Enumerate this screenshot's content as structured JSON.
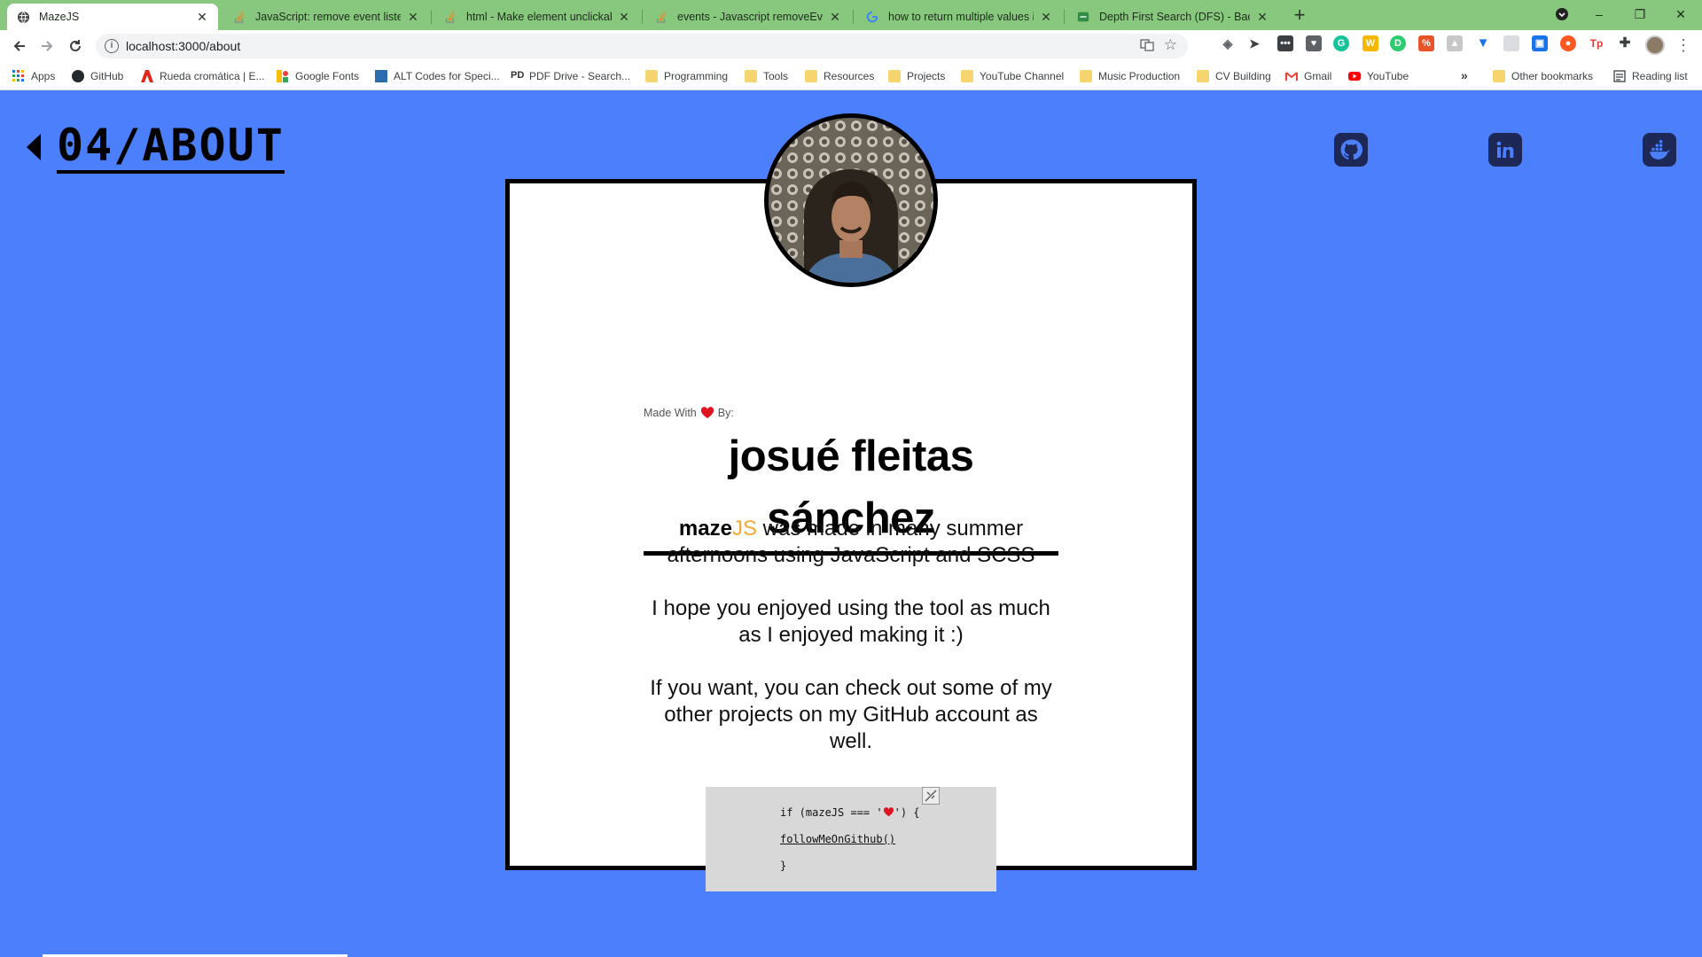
{
  "browser": {
    "tabs": [
      {
        "title": "MazeJS",
        "active": true,
        "favicon": "globe-icon"
      },
      {
        "title": "JavaScript: remove event listener",
        "active": false,
        "favicon": "stackoverflow-icon"
      },
      {
        "title": "html - Make element unclickable",
        "active": false,
        "favicon": "stackoverflow-icon"
      },
      {
        "title": "events - Javascript removeEventL",
        "active": false,
        "favicon": "stackoverflow-icon"
      },
      {
        "title": "how to return multiple values in",
        "active": false,
        "favicon": "google-icon"
      },
      {
        "title": "Depth First Search (DFS) - Backtr",
        "active": false,
        "favicon": "gfg-icon"
      }
    ],
    "tab_close": "✕",
    "new_tab": "+",
    "window_controls": {
      "minimize": "–",
      "maximize": "❐",
      "close": "✕"
    },
    "url": "localhost:3000/about",
    "bookmarks": [
      {
        "label": "Apps",
        "icon": "apps-grid-icon"
      },
      {
        "label": "GitHub",
        "icon": "github-icon"
      },
      {
        "label": "Rueda cromática | E...",
        "icon": "adobe-icon"
      },
      {
        "label": "Google Fonts",
        "icon": "google-fonts-icon"
      },
      {
        "label": "ALT Codes for Speci...",
        "icon": "altcodes-icon"
      },
      {
        "label": "PDF Drive - Search...",
        "icon": "pdfdrive-icon"
      },
      {
        "label": "Programming",
        "icon": "folder-icon"
      },
      {
        "label": "Tools",
        "icon": "folder-icon"
      },
      {
        "label": "Resources",
        "icon": "folder-icon"
      },
      {
        "label": "Projects",
        "icon": "folder-icon"
      },
      {
        "label": "YouTube Channel",
        "icon": "folder-icon"
      },
      {
        "label": "Music Production",
        "icon": "folder-icon"
      },
      {
        "label": "CV Building",
        "icon": "folder-icon"
      },
      {
        "label": "Gmail",
        "icon": "gmail-icon"
      },
      {
        "label": "YouTube",
        "icon": "youtube-icon"
      }
    ],
    "bookmarks_more": "»",
    "other_bookmarks": "Other bookmarks",
    "reading_list": "Reading list"
  },
  "page": {
    "title": "04/ABOUT",
    "made_with_prefix": "Made With",
    "made_with_suffix": "By:",
    "author": "josué fleitas sánchez",
    "brand_maze": "maze",
    "brand_js": "JS",
    "bio_1_rest": " was made in many summer afternoons using JavaScript and SCSS",
    "bio_2": "I hope you enjoyed using the tool as much as I enjoyed making it :)",
    "bio_3": "If you want, you can check out some of my other projects on my GitHub account as well.",
    "code_line_1_pre": "if (mazeJS === '",
    "code_line_1_post": "') {",
    "code_line_2": "followMeOnGithub()",
    "code_line_3": "}",
    "social_links": [
      "github-icon",
      "linkedin-icon",
      "docker-icon"
    ]
  },
  "colors": {
    "page_background": "#4b7ffc",
    "tabstrip": "#87c77e",
    "brand_js": "#f6a936",
    "heart": "#e0141e",
    "social_icon_bg": "#1d2856"
  }
}
